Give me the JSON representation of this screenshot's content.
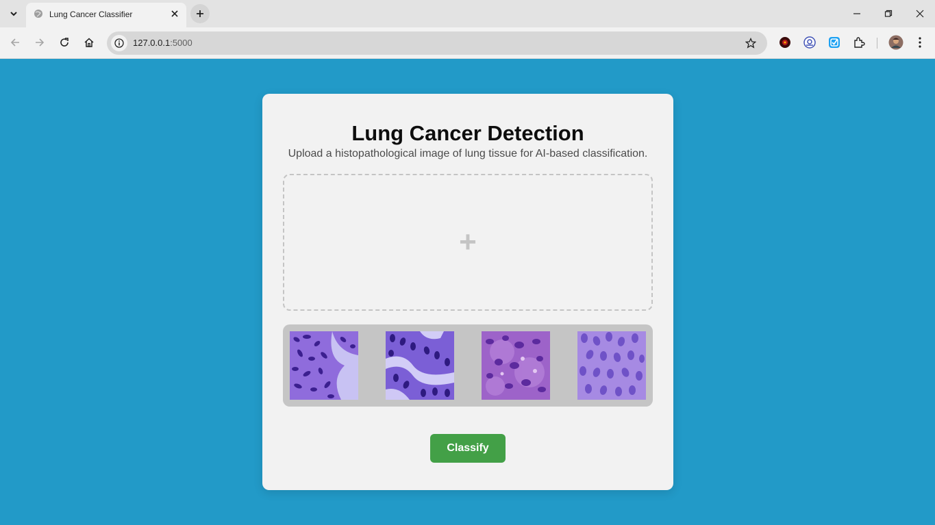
{
  "browser": {
    "tab": {
      "title": "Lung Cancer Classifier"
    },
    "address": {
      "host": "127.0.0.1",
      "port": ":5000"
    }
  },
  "page": {
    "title": "Lung Cancer Detection",
    "subtitle": "Upload a histopathological image of lung tissue for AI-based classification.",
    "upload": {
      "icon": "plus-icon",
      "symbol": "+"
    },
    "samples": [
      {
        "icon": "histology-sample-1"
      },
      {
        "icon": "histology-sample-2"
      },
      {
        "icon": "histology-sample-3"
      },
      {
        "icon": "histology-sample-4"
      }
    ],
    "classify_label": "Classify"
  },
  "colors": {
    "page_background": "#229ac8",
    "card_background": "#f2f2f2",
    "button_green": "#43a047",
    "sample_strip": "#c5c5c5"
  }
}
